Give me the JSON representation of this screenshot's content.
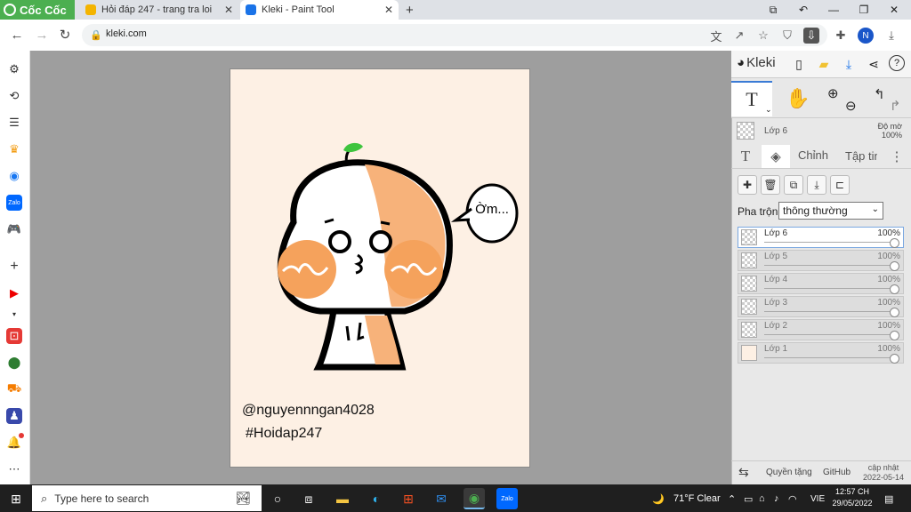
{
  "browser": {
    "brand": "Cốc Cốc",
    "tabs": [
      {
        "title": "Hỏi đáp 247 - trang tra loi",
        "active": false
      },
      {
        "title": "Kleki - Paint Tool",
        "active": true
      }
    ],
    "new_tab": "+",
    "url": "kleki.com",
    "profile_initial": "N"
  },
  "canvas": {
    "speech_text": "Ờm...",
    "credit_user": "@nguyennngan4028",
    "credit_tag": "#Hoidap247",
    "colors": {
      "paper": "#fdf0e4",
      "orange": "#f7b27a",
      "cheek": "#f5a25c",
      "sprout": "#3ec43e"
    }
  },
  "kleki": {
    "logo": "Kleki",
    "current_layer": {
      "name": "Lớp 6",
      "opacity_label": "Độ mờ",
      "opacity": "100%"
    },
    "tabs": {
      "text": "T",
      "edit": "Chỉnh sửa",
      "file": "Tập tin"
    },
    "blend_label": "Pha trộn",
    "blend_value": "thông thường",
    "layers": [
      {
        "name": "Lớp 6",
        "opacity": "100%",
        "selected": true
      },
      {
        "name": "Lớp 5",
        "opacity": "100%",
        "selected": false
      },
      {
        "name": "Lớp 4",
        "opacity": "100%",
        "selected": false
      },
      {
        "name": "Lớp 3",
        "opacity": "100%",
        "selected": false
      },
      {
        "name": "Lớp 2",
        "opacity": "100%",
        "selected": false
      },
      {
        "name": "Lớp 1",
        "opacity": "100%",
        "selected": false
      }
    ],
    "footer": {
      "privacy": "Quyền tặng",
      "github": "GitHub",
      "update_label": "cập nhật",
      "update_date": "2022-05-14"
    }
  },
  "taskbar": {
    "search_placeholder": "Type here to search",
    "weather": "71°F  Clear",
    "lang": "VIE",
    "time": "12:57 CH",
    "date": "29/05/2022"
  }
}
